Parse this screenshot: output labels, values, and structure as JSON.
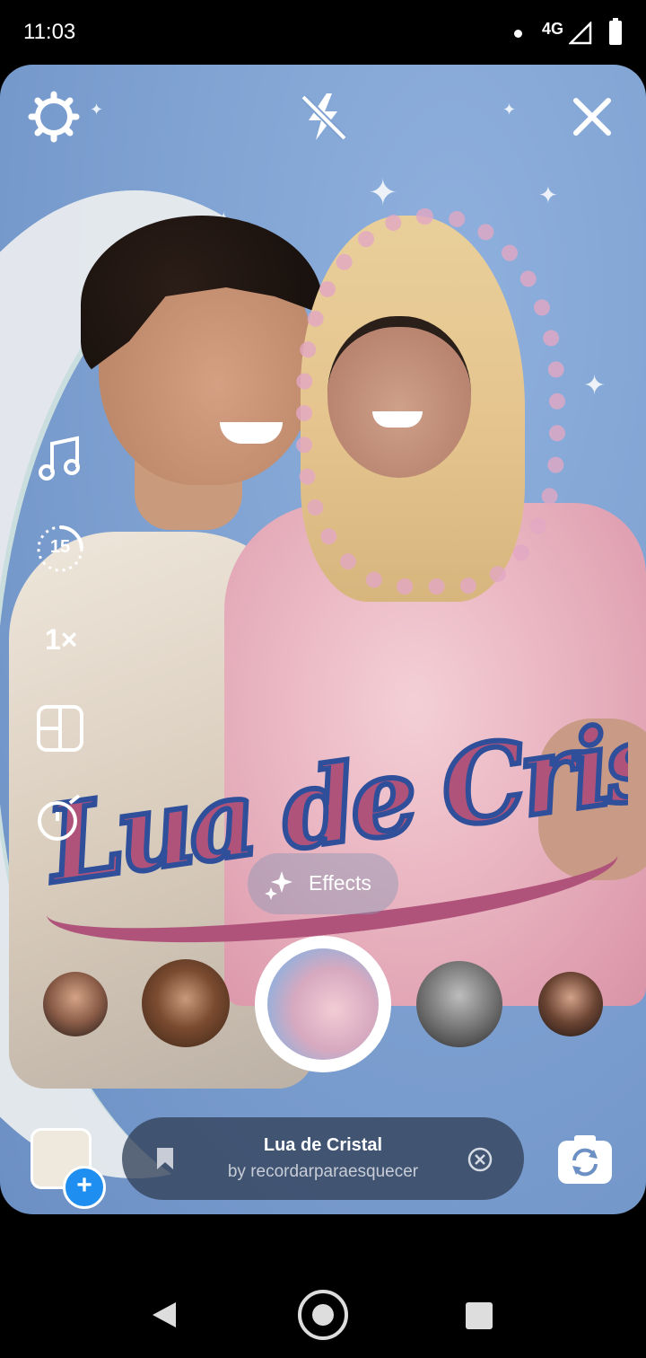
{
  "status_bar": {
    "time": "11:03",
    "network": "4G",
    "battery_icon": "battery-icon",
    "signal_icon": "signal-icon"
  },
  "camera": {
    "top_controls": {
      "settings_icon": "gear-icon",
      "flash_icon": "flash-off-icon",
      "close_icon": "close-icon"
    },
    "side_controls": {
      "music_icon": "music-note-icon",
      "duration_value": "15",
      "speed_label": "1×",
      "layout_icon": "layout-icon",
      "timer_icon": "timer-icon"
    },
    "effects_button": {
      "label": "Effects",
      "icon": "sparkles-icon"
    },
    "filter_carousel": {
      "selected_index": 2,
      "count": 5
    }
  },
  "bottom_bar": {
    "effect_name": "Lua de Cristal",
    "effect_author": "by recordarparaesquecer",
    "save_icon": "bookmark-icon",
    "dismiss_icon": "close-circle-icon",
    "gallery_plus": "+",
    "flip_icon": "camera-flip-icon"
  },
  "nav_bar": {
    "back_icon": "back-triangle-icon",
    "home_icon": "home-circle-icon",
    "recents_icon": "recents-square-icon"
  },
  "colors": {
    "sky": "#7fa2d2",
    "logo_pink": "#b0537a",
    "logo_blue": "#2f4f9a",
    "accent_blue": "#1f8ef1"
  }
}
